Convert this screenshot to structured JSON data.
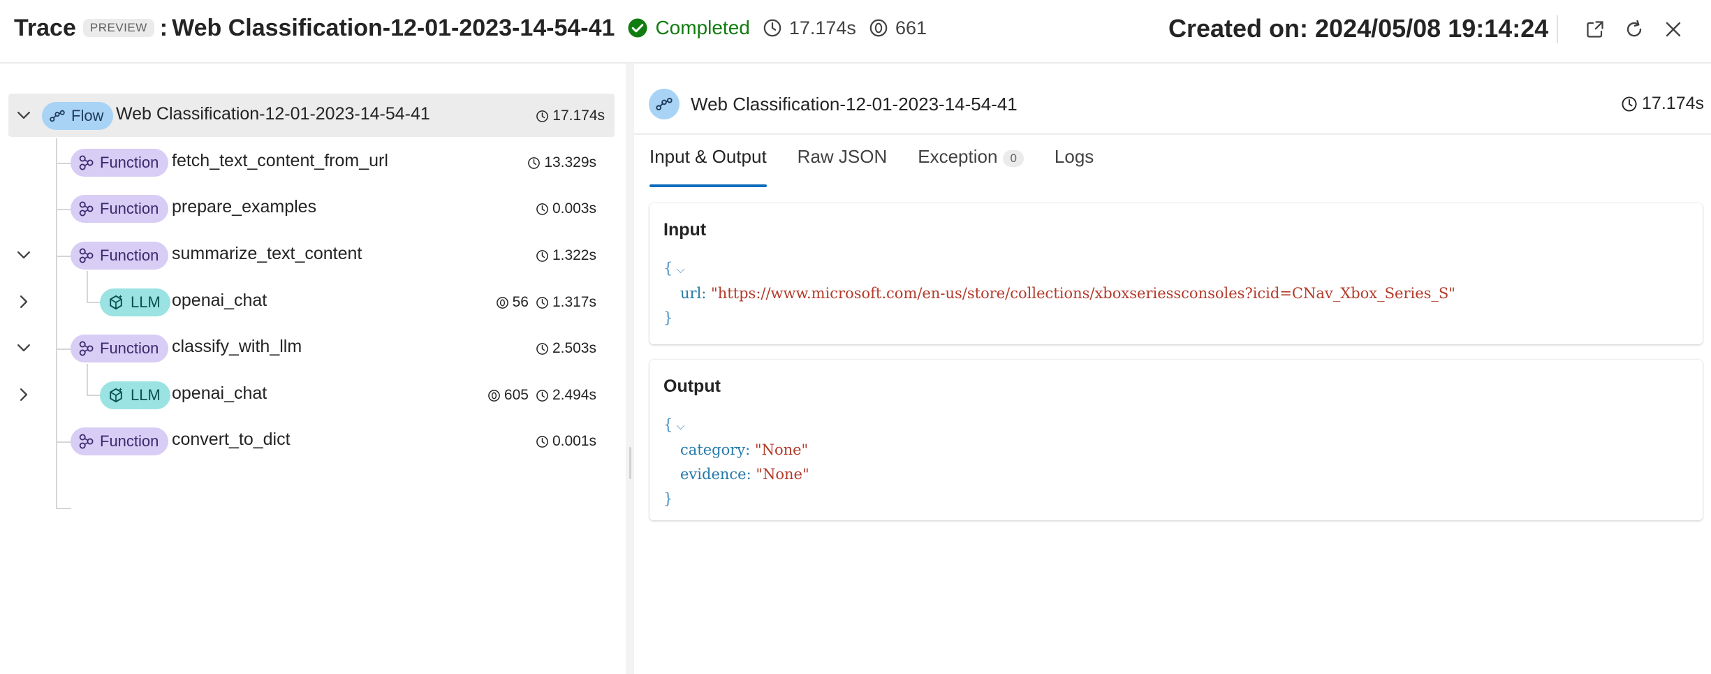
{
  "header": {
    "title": "Trace",
    "preview_badge": "PREVIEW",
    "separator": ":",
    "run_name": "Web Classification-12-01-2023-14-54-41",
    "status": "Completed",
    "duration": "17.174s",
    "tokens": "661",
    "created_on": "Created on: 2024/05/08 19:14:24",
    "actions": [
      "share-icon",
      "refresh-icon",
      "close-icon"
    ]
  },
  "tree": [
    {
      "type": "Flow",
      "name": "Web Classification-12-01-2023-14-54-41",
      "time": "17.174s",
      "tokens": "",
      "expanded": true
    },
    {
      "type": "Function",
      "name": "fetch_text_content_from_url",
      "time": "13.329s",
      "tokens": ""
    },
    {
      "type": "Function",
      "name": "prepare_examples",
      "time": "0.003s",
      "tokens": ""
    },
    {
      "type": "Function",
      "name": "summarize_text_content",
      "time": "1.322s",
      "tokens": "",
      "expanded": true
    },
    {
      "type": "LLM",
      "name": "openai_chat",
      "time": "1.317s",
      "tokens": "56",
      "expanded": false
    },
    {
      "type": "Function",
      "name": "classify_with_llm",
      "time": "2.503s",
      "tokens": "",
      "expanded": true
    },
    {
      "type": "LLM",
      "name": "openai_chat",
      "time": "2.494s",
      "tokens": "605",
      "expanded": false
    },
    {
      "type": "Function",
      "name": "convert_to_dict",
      "time": "0.001s",
      "tokens": ""
    }
  ],
  "detail": {
    "name": "Web Classification-12-01-2023-14-54-41",
    "time": "17.174s",
    "tabs": [
      {
        "label": "Input & Output",
        "count": ""
      },
      {
        "label": "Raw JSON",
        "count": ""
      },
      {
        "label": "Exception",
        "count": "0"
      },
      {
        "label": "Logs",
        "count": ""
      }
    ],
    "active_tab": "Input & Output",
    "input": {
      "title": "Input",
      "open_brace": "{",
      "close_brace": "}",
      "fields": [
        {
          "key": "url:",
          "value": "\"https://www.microsoft.com/en-us/store/collections/xboxseriessconsoles?icid=CNav_Xbox_Series_S\""
        }
      ]
    },
    "output": {
      "title": "Output",
      "open_brace": "{",
      "close_brace": "}",
      "fields": [
        {
          "key": "category:",
          "value": "\"None\""
        },
        {
          "key": "evidence:",
          "value": "\"None\""
        }
      ]
    }
  },
  "colors": {
    "accent": "#0f6cbd",
    "success": "#107c10",
    "flow_pill": "#a8d3f5",
    "function_pill": "#d8cdf5",
    "llm_pill": "#9be3e3"
  }
}
